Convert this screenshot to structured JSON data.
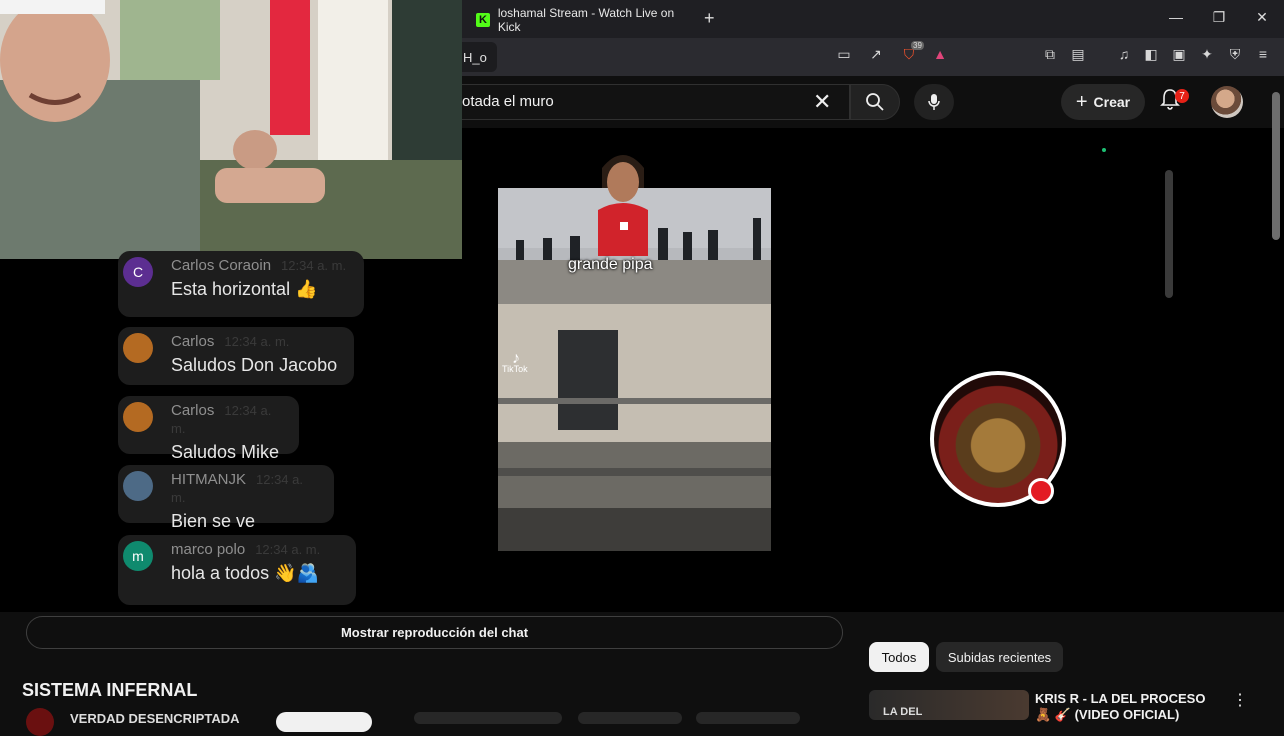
{
  "browser": {
    "tab_title": "loshamal Stream - Watch Live on Kick",
    "tab_icon": "kick-logo-icon",
    "new_tab": "+",
    "url_text": "H_o",
    "window_controls": [
      "—",
      "❐",
      "✕"
    ],
    "shield_badge": "39"
  },
  "youtube": {
    "search_text": "otada el muro",
    "create_label": "Crear",
    "notification_count": "7"
  },
  "chat": {
    "messages": [
      {
        "author": "Carlos Coraoin",
        "time": "12:34 a. m.",
        "text": "Esta horizontal 👍",
        "avatar_letter": "C",
        "avatar_color": "#5c2e91"
      },
      {
        "author": "Carlos",
        "time": "12:34 a. m.",
        "text": "Saludos Don Jacobo",
        "avatar_letter": "",
        "avatar_color": "#b46a22"
      },
      {
        "author": "Carlos",
        "time": "12:34 a. m.",
        "text": "Saludos Mike",
        "avatar_letter": "",
        "avatar_color": "#b46a22"
      },
      {
        "author": "HITMANJK",
        "time": "12:34 a. m.",
        "text": "Bien se ve",
        "avatar_letter": "",
        "avatar_color": "#4d6a86"
      },
      {
        "author": "marco polo",
        "time": "12:34 a. m.",
        "text": "hola a todos 👋🫂",
        "avatar_letter": "m",
        "avatar_color": "#0f8a6e"
      }
    ]
  },
  "clip": {
    "caption": "grande pipa",
    "watermark_brand": "TikTok"
  },
  "below": {
    "replay_button": "Mostrar reproducción del chat",
    "video_title": "SISTEMA INFERNAL",
    "channel_name_partial": "VERDAD DESENCRIPTADA",
    "chip_all": "Todos",
    "chip_recent": "Subidas recientes",
    "recommended_title": "KRIS R - LA DEL PROCESO 🧸 🎸 (VIDEO OFICIAL)",
    "recommended_thumb_text": "LA DEL"
  },
  "colors": {
    "kick_green": "#53fc18",
    "yt_bg": "#0f0f0f",
    "badge_red": "#e62117",
    "live_red": "#e31b23"
  }
}
